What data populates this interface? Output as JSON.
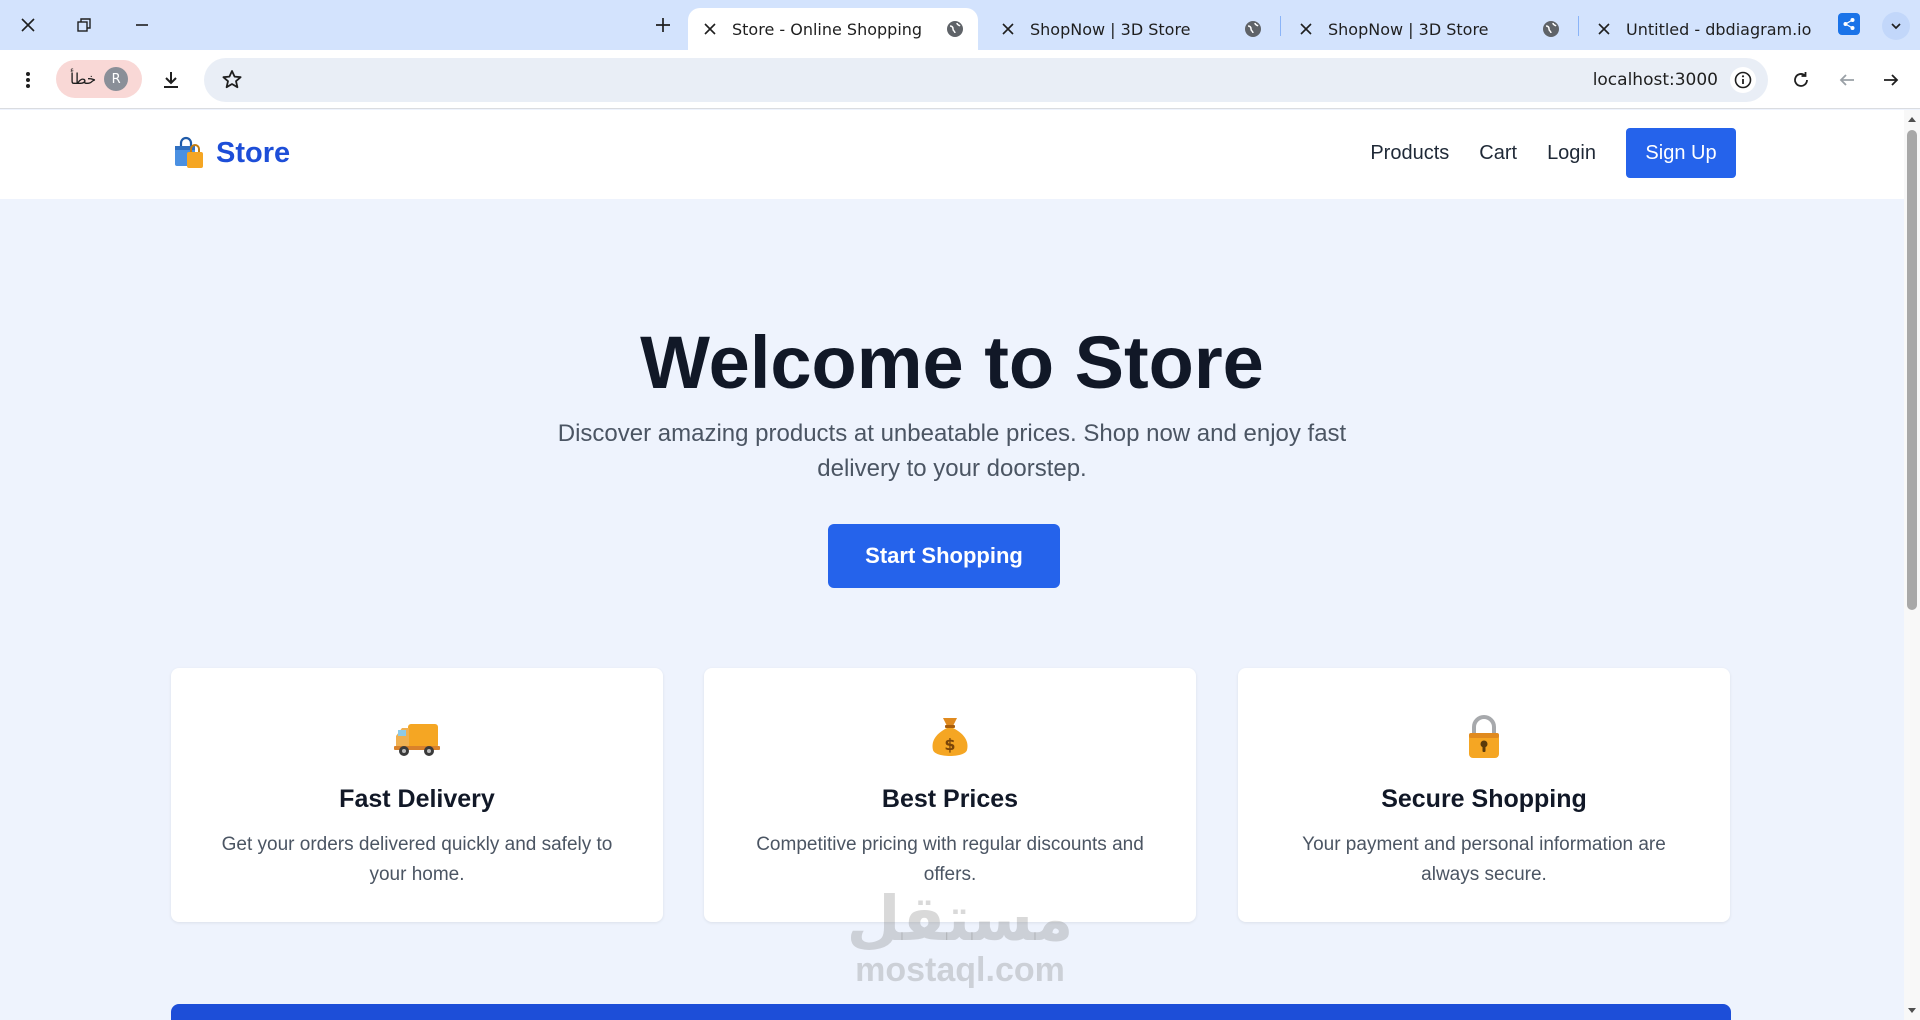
{
  "browser": {
    "tabs": [
      {
        "title": "Store - Online Shopping",
        "active": true
      },
      {
        "title": "ShopNow | 3D Store",
        "active": false
      },
      {
        "title": "ShopNow | 3D Store",
        "active": false
      },
      {
        "title": "Untitled - dbdiagram.io",
        "active": false
      }
    ],
    "profile": {
      "status_text": "خطأ",
      "initial": "R"
    },
    "url": "localhost:3000"
  },
  "header": {
    "brand_name": "Store",
    "nav": {
      "products": "Products",
      "cart": "Cart",
      "login": "Login",
      "signup": "Sign Up"
    }
  },
  "hero": {
    "title": "Welcome to Store",
    "subtitle": "Discover amazing products at unbeatable prices. Shop now and enjoy fast delivery to your doorstep.",
    "cta": "Start Shopping"
  },
  "features": [
    {
      "icon": "delivery-truck-icon",
      "title": "Fast Delivery",
      "text": "Get your orders delivered quickly and safely to your home."
    },
    {
      "icon": "money-bag-icon",
      "title": "Best Prices",
      "text": "Competitive pricing with regular discounts and offers."
    },
    {
      "icon": "lock-icon",
      "title": "Secure Shopping",
      "text": "Your payment and personal information are always secure."
    }
  ],
  "watermark": {
    "arabic": "مستقل",
    "latin": "mostaql.com"
  },
  "colors": {
    "primary": "#2563eb",
    "brand": "#1d4ed8",
    "page_bg": "#eef3fd",
    "tabstrip_bg": "#d3e3fd"
  }
}
